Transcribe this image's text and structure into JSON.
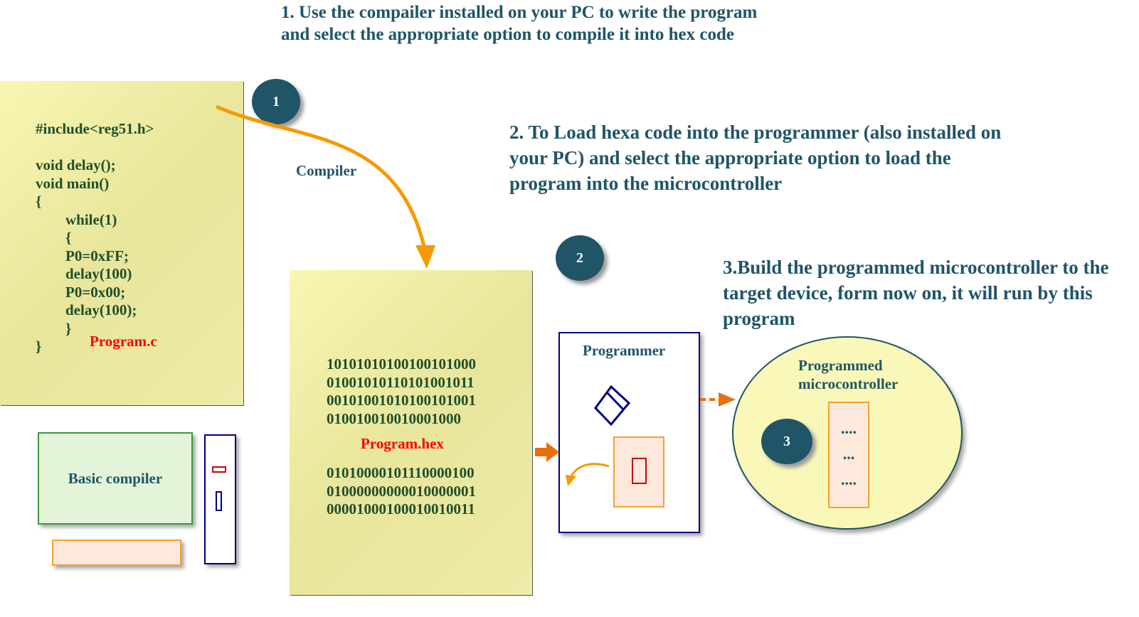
{
  "steps": {
    "step1": "1. Use the compailer installed on your PC to write the program and select the appropriate option to compile it into hex code",
    "step2": "2. To Load hexa code into the programmer (also installed on your PC) and select the appropriate option to load the program into the microcontroller",
    "step3": "3.Build the programmed microcontroller to the target device, form now on, it will run by this program"
  },
  "badges": [
    "1",
    "2",
    "3"
  ],
  "compiler_label": "Compiler",
  "source_file": {
    "lines": [
      "#include<reg51.h>",
      "",
      "void delay();",
      "void main()",
      "{",
      "        while(1)",
      "        {",
      "        P0=0xFF;",
      "        delay(100)",
      "        P0=0x00;",
      "        delay(100);",
      "        }",
      "}"
    ],
    "name": "Program.c"
  },
  "hex_file": {
    "lines_top": [
      "10101010100100101000",
      "01001010110101001011",
      "00101001010100101001",
      "010010010010001000"
    ],
    "name": "Program.hex",
    "lines_bottom": [
      "01010000101110000100",
      "01000000000010000001",
      "00001000100010010011"
    ]
  },
  "basic_compiler": "Basic compiler",
  "programmer": "Programmer",
  "mcu": {
    "label_line1": "Programmed",
    "label_line2": "microcontroller",
    "dots": [
      "....",
      "...",
      "...."
    ]
  },
  "colors": {
    "heading": "#1f5566",
    "code": "#1e4f2a",
    "filename": "#ff0000",
    "arrow": "#f59a00",
    "programmer_border": "#000080"
  }
}
